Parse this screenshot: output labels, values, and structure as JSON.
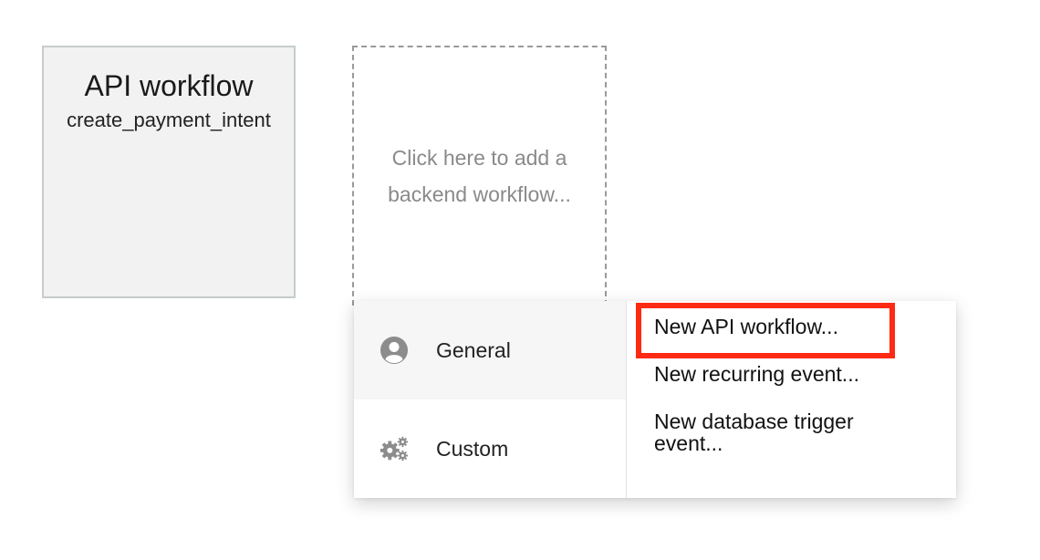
{
  "workflow_card": {
    "title": "API workflow",
    "name": "create_payment_intent"
  },
  "add_card": {
    "line1": "Click here to add a",
    "line2": "backend workflow..."
  },
  "menu": {
    "categories": [
      {
        "label": "General",
        "icon": "user-circle-icon",
        "active": true
      },
      {
        "label": "Custom",
        "icon": "gears-icon",
        "active": false
      }
    ],
    "options": [
      {
        "label": "New API workflow..."
      },
      {
        "label": "New recurring event..."
      },
      {
        "label": "New database trigger event..."
      }
    ]
  },
  "colors": {
    "highlight": "#ff2a14",
    "card_bg": "#f1f2f1",
    "card_border": "#c5cec9",
    "muted_text": "#8a8a8a",
    "icon": "#8c8c8c"
  }
}
